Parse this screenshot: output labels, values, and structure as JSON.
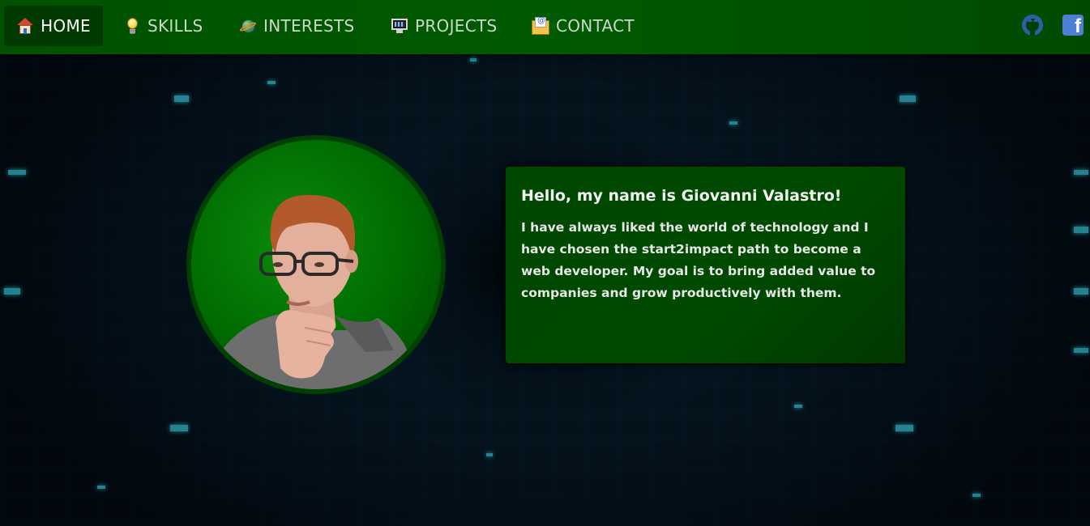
{
  "nav": {
    "items": [
      {
        "label": "HOME",
        "icon": "house-icon",
        "active": true
      },
      {
        "label": "SKILLS",
        "icon": "lightbulb-icon",
        "active": false
      },
      {
        "label": "INTERESTS",
        "icon": "globe-icon",
        "active": false
      },
      {
        "label": "PROJECTS",
        "icon": "monitor-icon",
        "active": false
      },
      {
        "label": "CONTACT",
        "icon": "mail-icon",
        "active": false
      }
    ],
    "social": [
      {
        "name": "github-icon"
      },
      {
        "name": "facebook-icon",
        "glyph": "f"
      }
    ]
  },
  "intro": {
    "title": "Hello, my name is Giovanni Valastro!",
    "text": "I have always liked the world of technology and I have chosen the start2impact path to become a web developer. My goal is to bring added value to companies and grow productively with them."
  },
  "colors": {
    "nav_background": "#005200",
    "nav_active": "#003a00",
    "card_background": "#004700",
    "avatar_background": "#006a00",
    "background": "#041019",
    "accent_cyan": "#35b4c4"
  }
}
